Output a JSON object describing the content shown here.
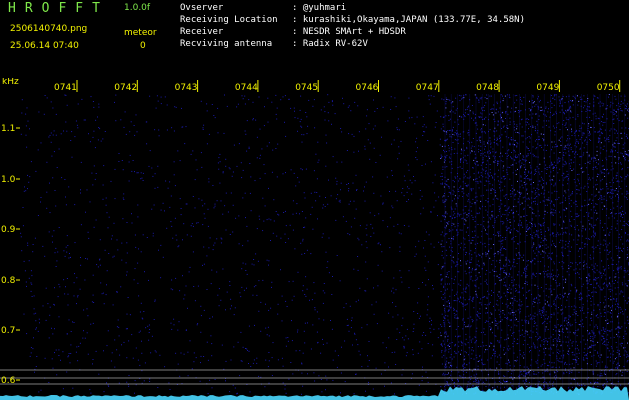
{
  "app": {
    "title": "HROFFT",
    "version": "1.0.0f",
    "file_name": "2506140740.png",
    "timestamp": "25.06.14 07:40",
    "mode": "meteor",
    "count": "0"
  },
  "station_info": [
    {
      "key": "Ovserver",
      "value": ": @yuhmari"
    },
    {
      "key": "Receiving Location",
      "value": ": kurashiki,Okayama,JAPAN (133.77E, 34.58N)"
    },
    {
      "key": "Receiver",
      "value": ": NESDR SMArt + HDSDR"
    },
    {
      "key": "Recviving antenna",
      "value": ": Radix RV-62V"
    }
  ],
  "spectrogram": {
    "y_unit": "kHz",
    "time_labels": [
      "0741",
      "0742",
      "0743",
      "0744",
      "0745",
      "0746",
      "0747",
      "0748",
      "0749",
      "0750"
    ],
    "freq_ticks": [
      "1.1",
      "1.0",
      "0.9",
      "0.8",
      "0.7",
      "0.6"
    ],
    "colors": {
      "background": "#000000",
      "noise": "#1a1aa8",
      "noise_bright": "#6c6cff",
      "signal": "#4ad8ff",
      "axis": "#f2f200",
      "guide": "#cfcfcf"
    }
  }
}
